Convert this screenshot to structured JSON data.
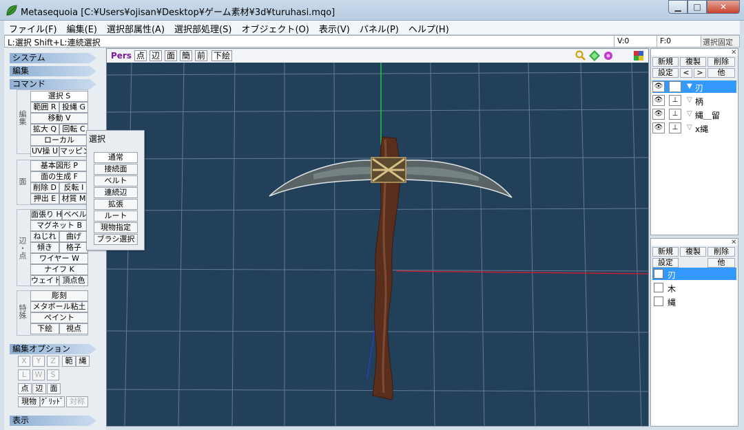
{
  "app": {
    "title": "Metasequoia [C:¥Users¥ojisan¥Desktop¥ゲーム素材¥3d¥turuhasi.mqo]",
    "min": "▁",
    "max": "□",
    "close": "✕"
  },
  "menu": [
    "ファイル(F)",
    "編集(E)",
    "選択部属性(A)",
    "選択部処理(S)",
    "オブジェクト(O)",
    "表示(V)",
    "パネル(P)",
    "ヘルプ(H)"
  ],
  "status": {
    "hint": "L:選択  Shift+L:連続選択",
    "v": "V:0",
    "f": "F:0",
    "lock": "選択固定"
  },
  "left": {
    "system": "システム",
    "edit": "編集",
    "command": "コマンド",
    "grp_edit": "編集",
    "grp_face": "面",
    "grp_edge": "辺・点",
    "grp_special": "特殊",
    "select": "選択 S",
    "range": "範囲 R",
    "lasso": "投縄 G",
    "move": "移動 V",
    "scale": "拡大 Q",
    "rotate": "回転 C",
    "local": "ローカル",
    "uv": "UV操 U",
    "mapping": "マッピング",
    "primitive": "基本図形 P",
    "face_gen": "面の生成 F",
    "delete": "削除 D",
    "flip": "反転 I",
    "extrude": "押出 E",
    "material": "材質 M",
    "face_fill": "面張り H",
    "bevel": "ベベル",
    "magnet": "マグネット B",
    "twist": "ねじれ",
    "bend": "曲げ",
    "tilt": "傾き",
    "lattice": "格子",
    "wire": "ワイヤー W",
    "knife": "ナイフ K",
    "weight": "ウェイト",
    "vcolor": "頂点色",
    "sculpt": "彫刻",
    "metaball": "メタボール粘土",
    "paint": "ペイント",
    "underlay": "下絵",
    "viewpoint": "視点",
    "edit_options": "編集オプション",
    "opt_x": "X",
    "opt_y": "Y",
    "opt_z": "Z",
    "opt_range": "範",
    "opt_lasso": "縄",
    "opt_l": "L",
    "opt_w": "W",
    "opt_s": "S",
    "opt_point": "点",
    "opt_edge": "辺",
    "opt_face": "面",
    "opt_current": "現物",
    "opt_grid": "ｸﾞﾘｯﾄﾞ",
    "opt_sym": "対称",
    "display": "表示"
  },
  "viewport": {
    "pers": "Pers",
    "point": "点",
    "edge": "辺",
    "face": "面",
    "simple": "簡",
    "front": "前",
    "underlay": "下絵"
  },
  "popup": {
    "title": "選択",
    "items": [
      "通常",
      "接続面",
      "ベルト",
      "連続辺",
      "拡張",
      "ルート",
      "現物指定",
      "ブラシ選択"
    ]
  },
  "objects": {
    "new": "新規",
    "copy": "複製",
    "delete": "削除",
    "settings": "設定",
    "prev": "<",
    "next": ">",
    "other": "他",
    "items": [
      {
        "name": "刃",
        "selected": true
      },
      {
        "name": "柄",
        "selected": false
      },
      {
        "name": "縄＿留",
        "selected": false
      },
      {
        "name": "x縄",
        "selected": false
      }
    ]
  },
  "materials": {
    "new": "新規",
    "copy": "複製",
    "delete": "削除",
    "settings": "設定",
    "other": "他",
    "items": [
      {
        "name": "刃",
        "selected": true
      },
      {
        "name": "木",
        "selected": false
      },
      {
        "name": "縄",
        "selected": false
      }
    ]
  },
  "colors": {
    "viewport_bg": "#23405a",
    "selection": "#3399ff",
    "title_bar": "#c9d9ea"
  }
}
